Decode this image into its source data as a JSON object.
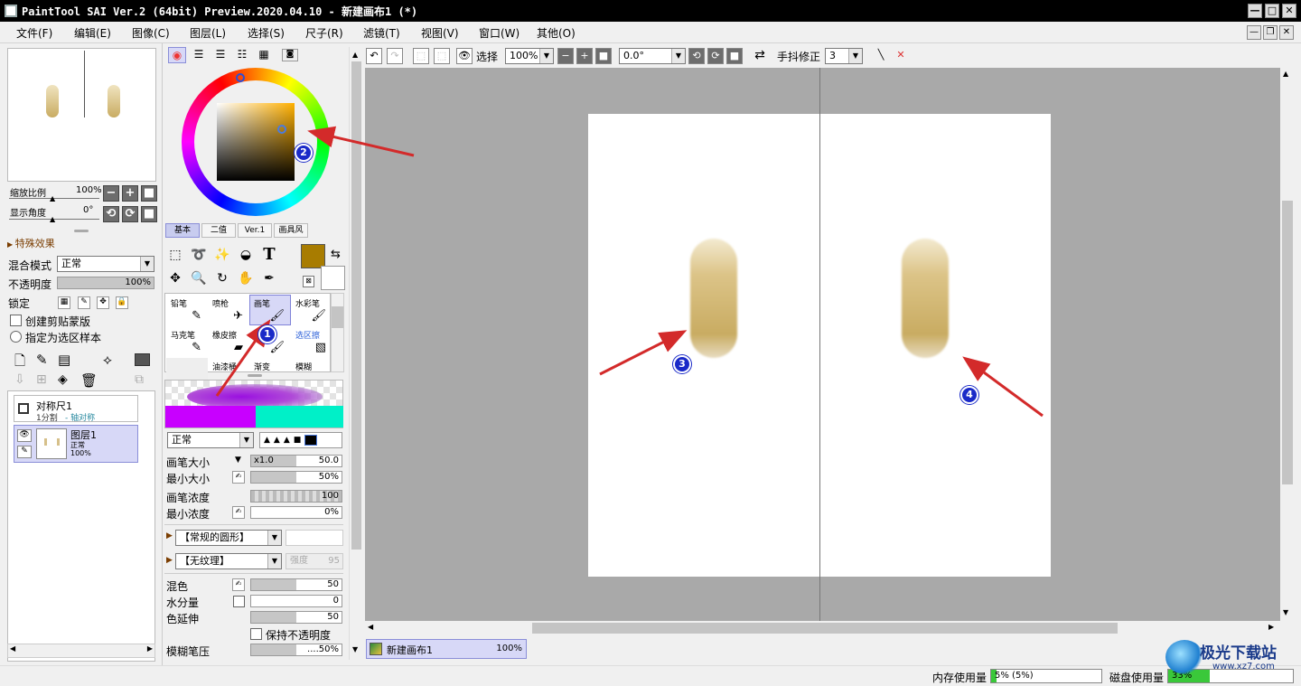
{
  "window": {
    "title": "PaintTool SAI Ver.2 (64bit) Preview.2020.04.10 - 新建画布1 (*)",
    "controls": [
      "—",
      "□",
      "✕"
    ]
  },
  "menu": [
    "文件(F)",
    "编辑(E)",
    "图像(C)",
    "图层(L)",
    "选择(S)",
    "尺子(R)",
    "滤镜(T)",
    "视图(V)",
    "窗口(W)",
    "其他(O)"
  ],
  "navigator": {
    "zoom_label": "缩放比例",
    "zoom_value": "100%",
    "angle_label": "显示角度",
    "angle_value": "0°"
  },
  "layer_panel": {
    "special_effects": "特殊效果",
    "blend_mode_label": "混合模式",
    "blend_mode_value": "正常",
    "opacity_label": "不透明度",
    "opacity_value": "100%",
    "lock_label": "锁定",
    "clip_mask_label": "创建剪贴蒙版",
    "selection_source_label": "指定为选区样本",
    "layers": [
      {
        "name": "对称尺1",
        "sub1": "1分割",
        "sub2": "- 轴对称"
      },
      {
        "name": "图层1",
        "sub1": "正常",
        "sub2": "100%"
      }
    ]
  },
  "color_tabs": [
    "基本",
    "二值",
    "Ver.1",
    "画具风"
  ],
  "brushes": [
    {
      "name": "铅笔",
      "icon": "pencil-icon",
      "glyph": "✎"
    },
    {
      "name": "喷枪",
      "icon": "airbrush-icon",
      "glyph": "✈"
    },
    {
      "name": "画笔",
      "icon": "brush-icon",
      "glyph": "🖌"
    },
    {
      "name": "水彩笔",
      "icon": "watercolor-icon",
      "glyph": "🖌"
    },
    {
      "name": "马克笔",
      "icon": "marker-icon",
      "glyph": "✎"
    },
    {
      "name": "橡皮擦",
      "icon": "eraser-icon",
      "glyph": "▰"
    },
    {
      "name": "",
      "icon": "brush-icon",
      "glyph": "🖌"
    },
    {
      "name": "选区擦",
      "icon": "select-erase-icon",
      "glyph": "▧"
    },
    {
      "name": "",
      "icon": "blank",
      "glyph": ""
    },
    {
      "name": "油漆桶",
      "icon": "bucket-icon",
      "glyph": ""
    },
    {
      "name": "渐变",
      "icon": "gradient-icon",
      "glyph": ""
    },
    {
      "name": "模糊",
      "icon": "blur-icon",
      "glyph": ""
    }
  ],
  "brush_settings": {
    "mode_value": "正常",
    "size_label": "画笔大小",
    "size_mult": "x1.0",
    "size_value": "50.0",
    "min_size_label": "最小大小",
    "min_size_value": "50%",
    "density_label": "画笔浓度",
    "density_value": "100",
    "min_density_label": "最小浓度",
    "min_density_value": "0%",
    "shape_value": "【常规的圆形】",
    "texture_value": "【无纹理】",
    "texture_strength": "强度",
    "texture_strength_value": "95",
    "blend_label": "混色",
    "blend_value": "50",
    "water_label": "水分量",
    "water_value": "0",
    "color_ext_label": "色延伸",
    "color_ext_value": "50",
    "keep_opacity_label": "保持不透明度",
    "blur_pressure_label": "模糊笔压",
    "blur_pressure_value": "....50%"
  },
  "canvas_toolbar": {
    "select_label": "选择",
    "zoom": "100%",
    "angle": "0.0°",
    "stabilizer_label": "手抖修正",
    "stabilizer_value": "3"
  },
  "canvas_tab": {
    "name": "新建画布1",
    "zoom": "100%"
  },
  "status": {
    "memory_label": "内存使用量",
    "memory_value": "5%  (5%)",
    "disk_label": "磁盘使用量",
    "disk_value": "33%"
  },
  "markers": [
    "1",
    "2",
    "3",
    "4"
  ],
  "watermark": {
    "name": "极光下载站",
    "url": "www.xz7.com"
  },
  "colors": {
    "primary": "#a87c00",
    "secondary": "#ffffff",
    "accent": "#d32a2a",
    "marker": "#1a2ac8"
  }
}
